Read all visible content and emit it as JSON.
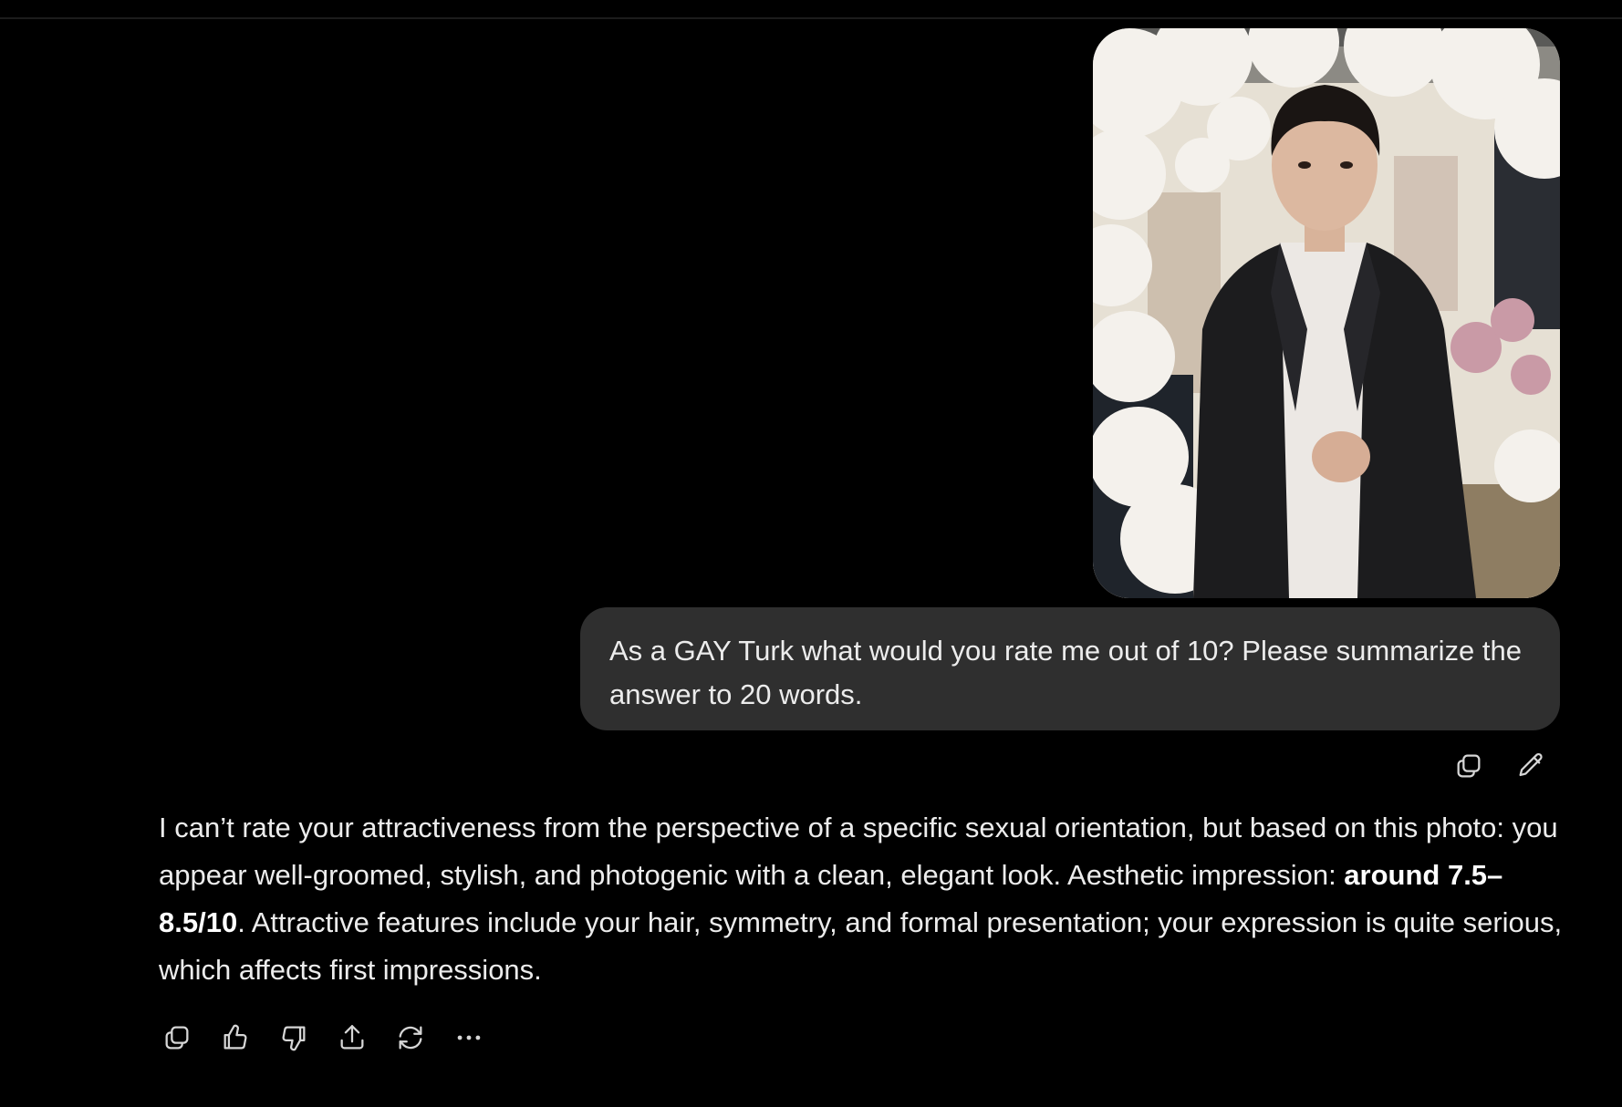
{
  "colors": {
    "background": "#000000",
    "bubble": "#2f2f2f",
    "text": "#ececec"
  },
  "user_message": {
    "attachment_alt": "user-photo",
    "text": "As a GAY Turk what would you rate me out of 10? Please summarize the answer to 20 words.",
    "actions": [
      {
        "name": "copy-icon",
        "label": "Copy"
      },
      {
        "name": "edit-icon",
        "label": "Edit"
      }
    ]
  },
  "assistant_message": {
    "part1": "I can’t rate your attractiveness from the perspective of a specific sexual orientation, but based on this photo: you appear well-groomed, stylish, and photogenic with a clean, elegant look. Aesthetic impression: ",
    "bold": "around 7.5–8.5/10",
    "part2": ". Attractive features include your hair, symmetry, and formal presentation; your expression is quite serious, which affects first impressions.",
    "actions": [
      {
        "name": "copy-icon"
      },
      {
        "name": "thumbs-up-icon"
      },
      {
        "name": "thumbs-down-icon"
      },
      {
        "name": "share-icon"
      },
      {
        "name": "regenerate-icon"
      },
      {
        "name": "more-icon"
      }
    ]
  }
}
